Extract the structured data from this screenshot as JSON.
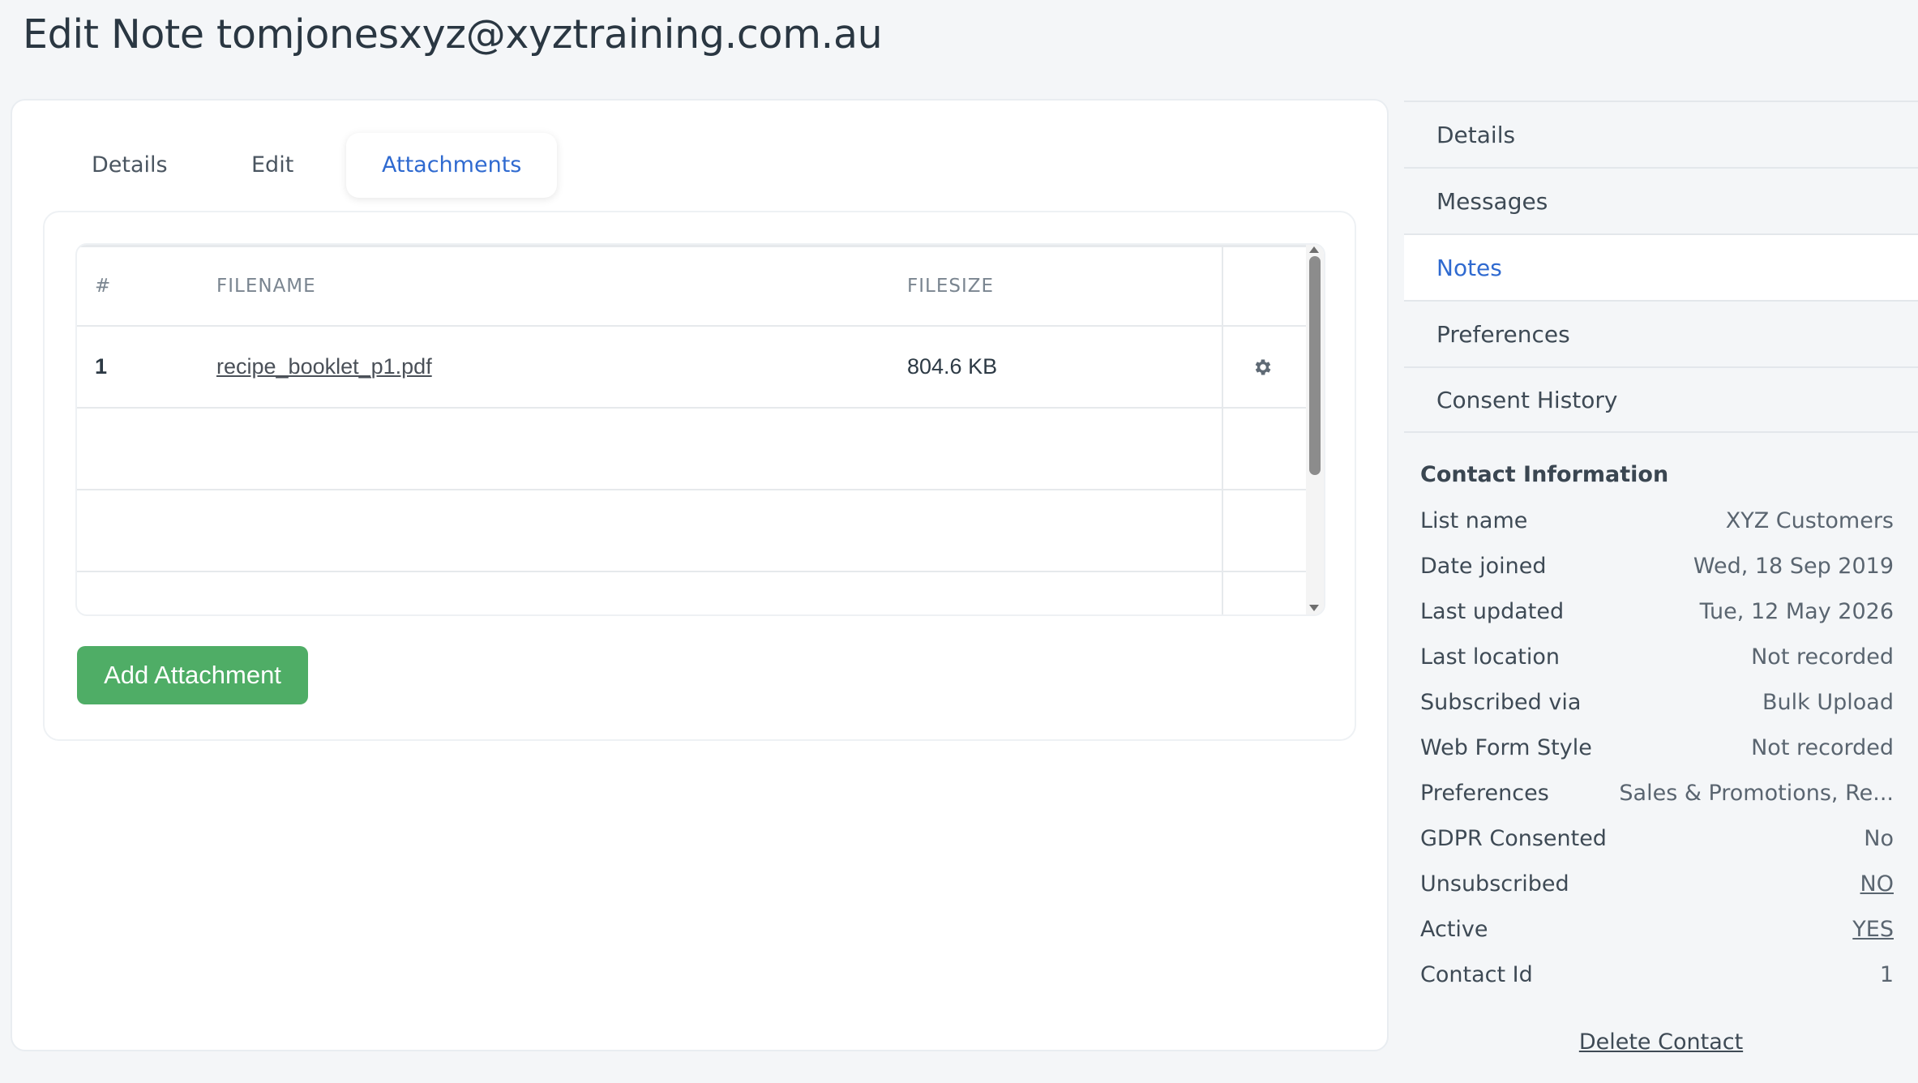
{
  "page": {
    "title": "Edit Note tomjonesxyz@xyztraining.com.au"
  },
  "tabs": [
    {
      "label": "Details"
    },
    {
      "label": "Edit"
    },
    {
      "label": "Attachments"
    }
  ],
  "table": {
    "headers": {
      "num": "#",
      "filename": "FILENAME",
      "filesize": "FILESIZE"
    },
    "rows": [
      {
        "num": "1",
        "filename": "recipe_booklet_p1.pdf",
        "filesize": "804.6 KB"
      }
    ]
  },
  "actions": {
    "add_attachment": "Add Attachment"
  },
  "sidebar": {
    "items": [
      {
        "label": "Details"
      },
      {
        "label": "Messages"
      },
      {
        "label": "Notes"
      },
      {
        "label": "Preferences"
      },
      {
        "label": "Consent History"
      }
    ],
    "active": "Notes"
  },
  "contact": {
    "title": "Contact Information",
    "rows": [
      {
        "label": "List name",
        "value": "XYZ Customers"
      },
      {
        "label": "Date joined",
        "value": "Wed, 18 Sep 2019"
      },
      {
        "label": "Last updated",
        "value": "Tue, 12 May 2026"
      },
      {
        "label": "Last location",
        "value": "Not recorded"
      },
      {
        "label": "Subscribed via",
        "value": "Bulk Upload"
      },
      {
        "label": "Web Form Style",
        "value": "Not recorded"
      },
      {
        "label": "Preferences",
        "value": "Sales & Promotions, Re..."
      },
      {
        "label": "GDPR Consented",
        "value": "No"
      },
      {
        "label": "Unsubscribed",
        "value": "NO"
      },
      {
        "label": "Active",
        "value": "YES"
      },
      {
        "label": "Contact Id",
        "value": "1"
      }
    ],
    "delete_label": "Delete Contact"
  },
  "colors": {
    "accent": "#2f6ad0",
    "button_green": "#4fad66",
    "background": "#f4f6f8"
  },
  "icons": {
    "row_action": "gear-icon"
  }
}
